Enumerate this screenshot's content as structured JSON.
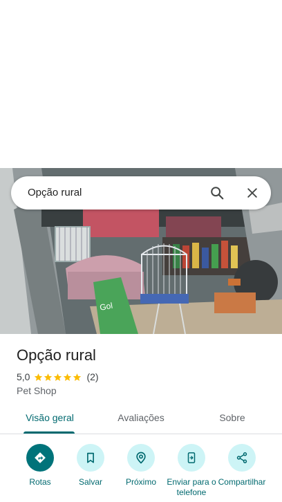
{
  "search": {
    "query": "Opção rural",
    "search_icon": "search-icon",
    "close_icon": "close-icon"
  },
  "place": {
    "name": "Opção rural",
    "rating": "5,0",
    "stars": 5,
    "review_count": "(2)",
    "category": "Pet Shop",
    "star_color": "#fbbc04"
  },
  "tabs": [
    {
      "label": "Visão geral",
      "active": true
    },
    {
      "label": "Avaliações",
      "active": false
    },
    {
      "label": "Sobre",
      "active": false
    }
  ],
  "actions": [
    {
      "label": "Rotas",
      "icon": "directions-icon"
    },
    {
      "label": "Salvar",
      "icon": "bookmark-icon"
    },
    {
      "label": "Próximo",
      "icon": "nearby-icon"
    },
    {
      "label": "Enviar para o telefone",
      "icon": "send-to-phone-icon"
    },
    {
      "label": "Compartilhar",
      "icon": "share-icon"
    }
  ],
  "colors": {
    "accent": "#00696f",
    "action_bg": "#cdf4f6",
    "primary_action_bg": "#00737a"
  }
}
